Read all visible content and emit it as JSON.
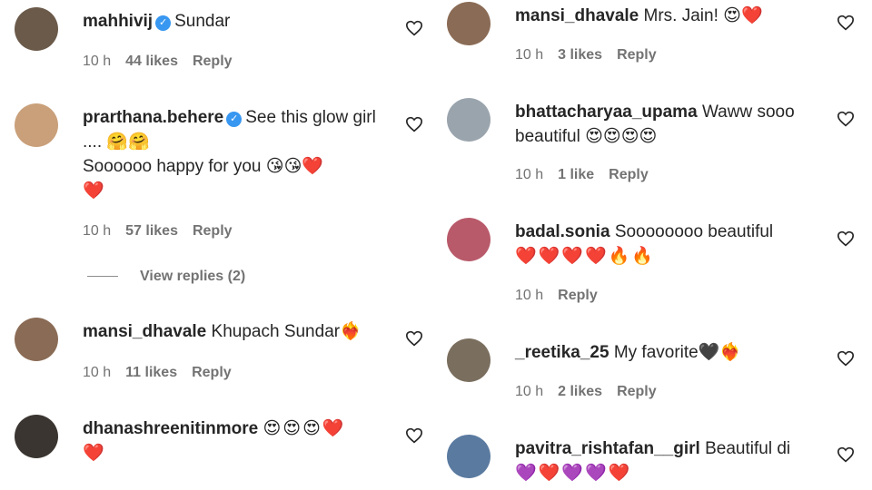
{
  "left": [
    {
      "username": "mahhivij",
      "verified": true,
      "text": "Sundar",
      "emoji_line2": "",
      "time": "10 h",
      "likes": "44 likes",
      "reply": "Reply",
      "avatar_color": "#6b5a4a"
    },
    {
      "username": "prarthana.behere",
      "verified": true,
      "text": "See this glow girl .... 🤗🤗",
      "text2": "Soooooo happy for you 😘😘❤️",
      "emoji_line2": "❤️",
      "time": "10 h",
      "likes": "57 likes",
      "reply": "Reply",
      "avatar_color": "#c9a07a"
    },
    {
      "username": "mansi_dhavale",
      "verified": false,
      "text": "Khupach Sundar❤️‍🔥",
      "emoji_line2": "",
      "time": "10 h",
      "likes": "11 likes",
      "reply": "Reply",
      "avatar_color": "#8a6b55"
    },
    {
      "username": "dhanashreenitinmore",
      "verified": false,
      "text": "😍😍😍❤️",
      "emoji_line2": "❤️",
      "time": "",
      "likes": "",
      "reply": "",
      "avatar_color": "#3a3530"
    }
  ],
  "view_replies": "View replies (2)",
  "right": [
    {
      "username": "mansi_dhavale",
      "verified": false,
      "text": "Mrs. Jain! 😍❤️",
      "emoji_line2": "",
      "time": "10 h",
      "likes": "3 likes",
      "reply": "Reply",
      "avatar_color": "#8a6b55"
    },
    {
      "username": "bhattacharyaa_upama",
      "verified": false,
      "text": "Waww sooo beautiful 😍😍😍😍",
      "emoji_line2": "",
      "time": "10 h",
      "likes": "1 like",
      "reply": "Reply",
      "avatar_color": "#9aa4ad"
    },
    {
      "username": "badal.sonia",
      "verified": false,
      "text": "Soooooooo beautiful",
      "emoji_line2": "❤️❤️❤️❤️🔥🔥",
      "time": "10 h",
      "likes": "",
      "reply": "Reply",
      "avatar_color": "#b85a6a"
    },
    {
      "username": "_reetika_25",
      "verified": false,
      "text": "My favorite🖤❤️‍🔥",
      "emoji_line2": "",
      "time": "10 h",
      "likes": "2 likes",
      "reply": "Reply",
      "avatar_color": "#7a6e5e"
    },
    {
      "username": "pavitra_rishtafan__girl",
      "verified": false,
      "text": "Beautiful di",
      "emoji_line2": "💜❤️💜💜❤️",
      "time": "",
      "likes": "",
      "reply": "",
      "avatar_color": "#5a7aa0"
    }
  ],
  "icons": {
    "like": "heart-outline-icon",
    "verified": "verified-badge-icon"
  },
  "colors": {
    "text": "#262626",
    "meta": "#737373",
    "verified": "#3897f0"
  }
}
